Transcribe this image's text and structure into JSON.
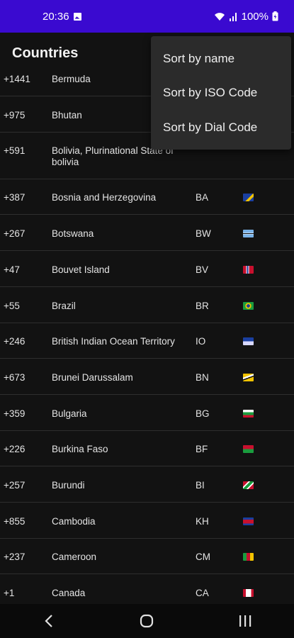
{
  "status": {
    "time": "20:36",
    "battery": "100%"
  },
  "header": {
    "title": "Countries"
  },
  "menu": {
    "items": [
      "Sort by name",
      "Sort by ISO Code",
      "Sort by Dial Code"
    ]
  },
  "countries": [
    {
      "dial": "+1441",
      "name": "Bermuda",
      "iso": "",
      "flag": ""
    },
    {
      "dial": "+975",
      "name": "Bhutan",
      "iso": "",
      "flag": ""
    },
    {
      "dial": "+591",
      "name": "Bolivia, Plurinational State of\nbolivia",
      "iso": "",
      "flag": ""
    },
    {
      "dial": "+387",
      "name": "Bosnia and Herzegovina",
      "iso": "BA",
      "flag": "ba"
    },
    {
      "dial": "+267",
      "name": "Botswana",
      "iso": "BW",
      "flag": "bw"
    },
    {
      "dial": "+47",
      "name": "Bouvet Island",
      "iso": "BV",
      "flag": "bv"
    },
    {
      "dial": "+55",
      "name": "Brazil",
      "iso": "BR",
      "flag": "br"
    },
    {
      "dial": "+246",
      "name": "British Indian Ocean Territory",
      "iso": "IO",
      "flag": "io"
    },
    {
      "dial": "+673",
      "name": "Brunei Darussalam",
      "iso": "BN",
      "flag": "bn"
    },
    {
      "dial": "+359",
      "name": "Bulgaria",
      "iso": "BG",
      "flag": "bg"
    },
    {
      "dial": "+226",
      "name": "Burkina Faso",
      "iso": "BF",
      "flag": "bf"
    },
    {
      "dial": "+257",
      "name": "Burundi",
      "iso": "BI",
      "flag": "bi"
    },
    {
      "dial": "+855",
      "name": "Cambodia",
      "iso": "KH",
      "flag": "kh"
    },
    {
      "dial": "+237",
      "name": "Cameroon",
      "iso": "CM",
      "flag": "cm"
    },
    {
      "dial": "+1",
      "name": "Canada",
      "iso": "CA",
      "flag": "ca"
    }
  ],
  "colors": {
    "status_bar": "#3a0ad0",
    "background": "#121212",
    "menu": "#2b2b2b"
  },
  "nav": {
    "icons": [
      "back-icon",
      "home-icon",
      "recents-icon"
    ]
  }
}
